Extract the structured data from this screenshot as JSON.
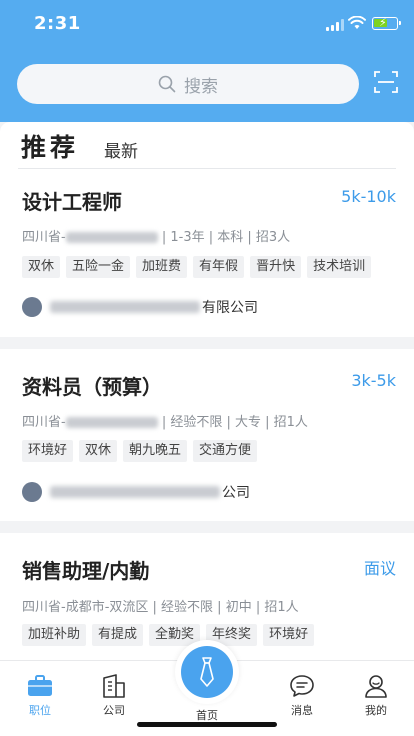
{
  "status": {
    "time": "2:31"
  },
  "search": {
    "placeholder": "搜索"
  },
  "tabs": {
    "recommended": "推荐",
    "latest": "最新"
  },
  "jobs": [
    {
      "title": "设计工程师",
      "salary": "5k-10k",
      "location_prefix": "四川省-",
      "details": "| 1-3年 | 本科 | 招3人",
      "tags": [
        "双休",
        "五险一金",
        "加班费",
        "有年假",
        "晋升快",
        "技术培训"
      ],
      "company_suffix": "有限公司"
    },
    {
      "title": "资料员（预算）",
      "salary": "3k-5k",
      "location_prefix": "四川省-",
      "details": "| 经验不限 | 大专 | 招1人",
      "tags": [
        "环境好",
        "双休",
        "朝九晚五",
        "交通方便"
      ],
      "company_suffix": "公司"
    },
    {
      "title": "销售助理/内勤",
      "salary": "面议",
      "location_prefix": "四川省-成都市-双流区",
      "details": "| 经验不限 | 初中 | 招1人",
      "tags": [
        "加班补助",
        "有提成",
        "全勤奖",
        "年终奖",
        "环境好"
      ],
      "company_suffix": ""
    }
  ],
  "tabbar": {
    "jobs": "职位",
    "company": "公司",
    "home": "首页",
    "messages": "消息",
    "mine": "我的"
  },
  "colors": {
    "primary": "#55acf0",
    "accent": "#4aa3ee",
    "salary": "#3d9be9"
  }
}
